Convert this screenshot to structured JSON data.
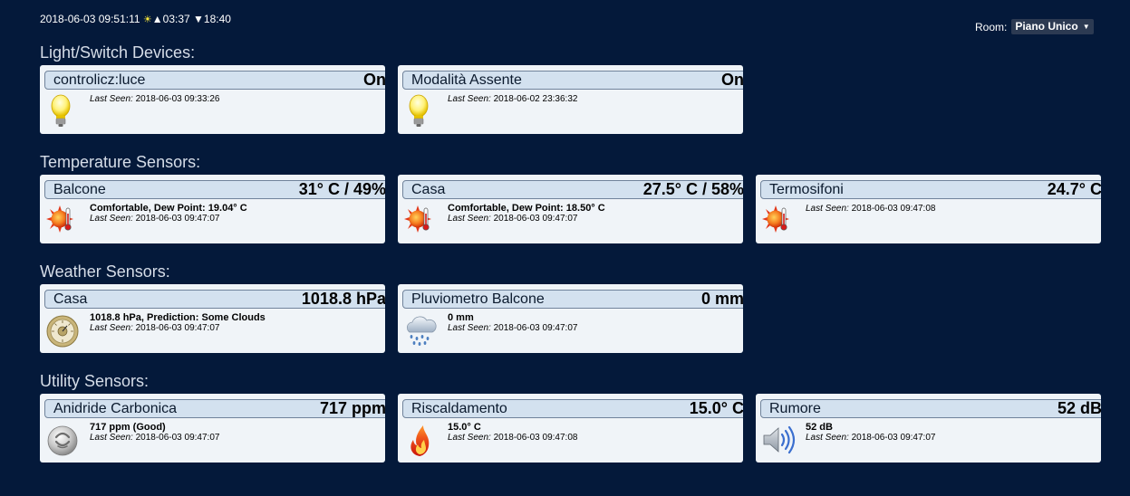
{
  "header": {
    "datetime": "2018-06-03 09:51:11",
    "sun_icon": "sun-icon",
    "sunrise_marker": "▲",
    "sunrise": "03:37",
    "sunset_marker": "▼",
    "sunset": "18:40",
    "room_label": "Room:",
    "room_selected": "Piano Unico"
  },
  "last_seen_label": "Last Seen:",
  "sections": [
    {
      "title": "Light/Switch Devices:",
      "cards": [
        {
          "name": "controlicz:luce",
          "value": "On",
          "detail": "",
          "last_seen": "2018-06-03 09:33:26",
          "icon": "lightbulb-icon"
        },
        {
          "name": "Modalità Assente",
          "value": "On",
          "detail": "",
          "last_seen": "2018-06-02 23:36:32",
          "icon": "lightbulb-icon"
        }
      ]
    },
    {
      "title": "Temperature Sensors:",
      "cards": [
        {
          "name": "Balcone",
          "value": "31° C / 49%",
          "detail": "Comfortable, Dew Point: 19.04° C",
          "last_seen": "2018-06-03 09:47:07",
          "icon": "thermometer-sun-icon"
        },
        {
          "name": "Casa",
          "value": "27.5° C / 58%",
          "detail": "Comfortable, Dew Point: 18.50° C",
          "last_seen": "2018-06-03 09:47:07",
          "icon": "thermometer-sun-icon"
        },
        {
          "name": "Termosifoni",
          "value": "24.7° C",
          "detail": "",
          "last_seen": "2018-06-03 09:47:08",
          "icon": "thermometer-sun-icon"
        }
      ]
    },
    {
      "title": "Weather Sensors:",
      "cards": [
        {
          "name": "Casa",
          "value": "1018.8 hPa",
          "detail": "1018.8 hPa, Prediction: Some Clouds",
          "last_seen": "2018-06-03 09:47:07",
          "icon": "barometer-icon"
        },
        {
          "name": "Pluviometro Balcone",
          "value": "0 mm",
          "detail": "0 mm",
          "last_seen": "2018-06-03 09:47:07",
          "icon": "rain-cloud-icon"
        }
      ]
    },
    {
      "title": "Utility Sensors:",
      "cards": [
        {
          "name": "Anidride Carbonica",
          "value": "717 ppm",
          "detail": "717 ppm (Good)",
          "last_seen": "2018-06-03 09:47:07",
          "icon": "air-quality-icon"
        },
        {
          "name": "Riscaldamento",
          "value": "15.0° C",
          "detail": "15.0° C",
          "last_seen": "2018-06-03 09:47:08",
          "icon": "flame-icon"
        },
        {
          "name": "Rumore",
          "value": "52 dB",
          "detail": "52 dB",
          "last_seen": "2018-06-03 09:47:07",
          "icon": "speaker-icon"
        }
      ]
    }
  ]
}
